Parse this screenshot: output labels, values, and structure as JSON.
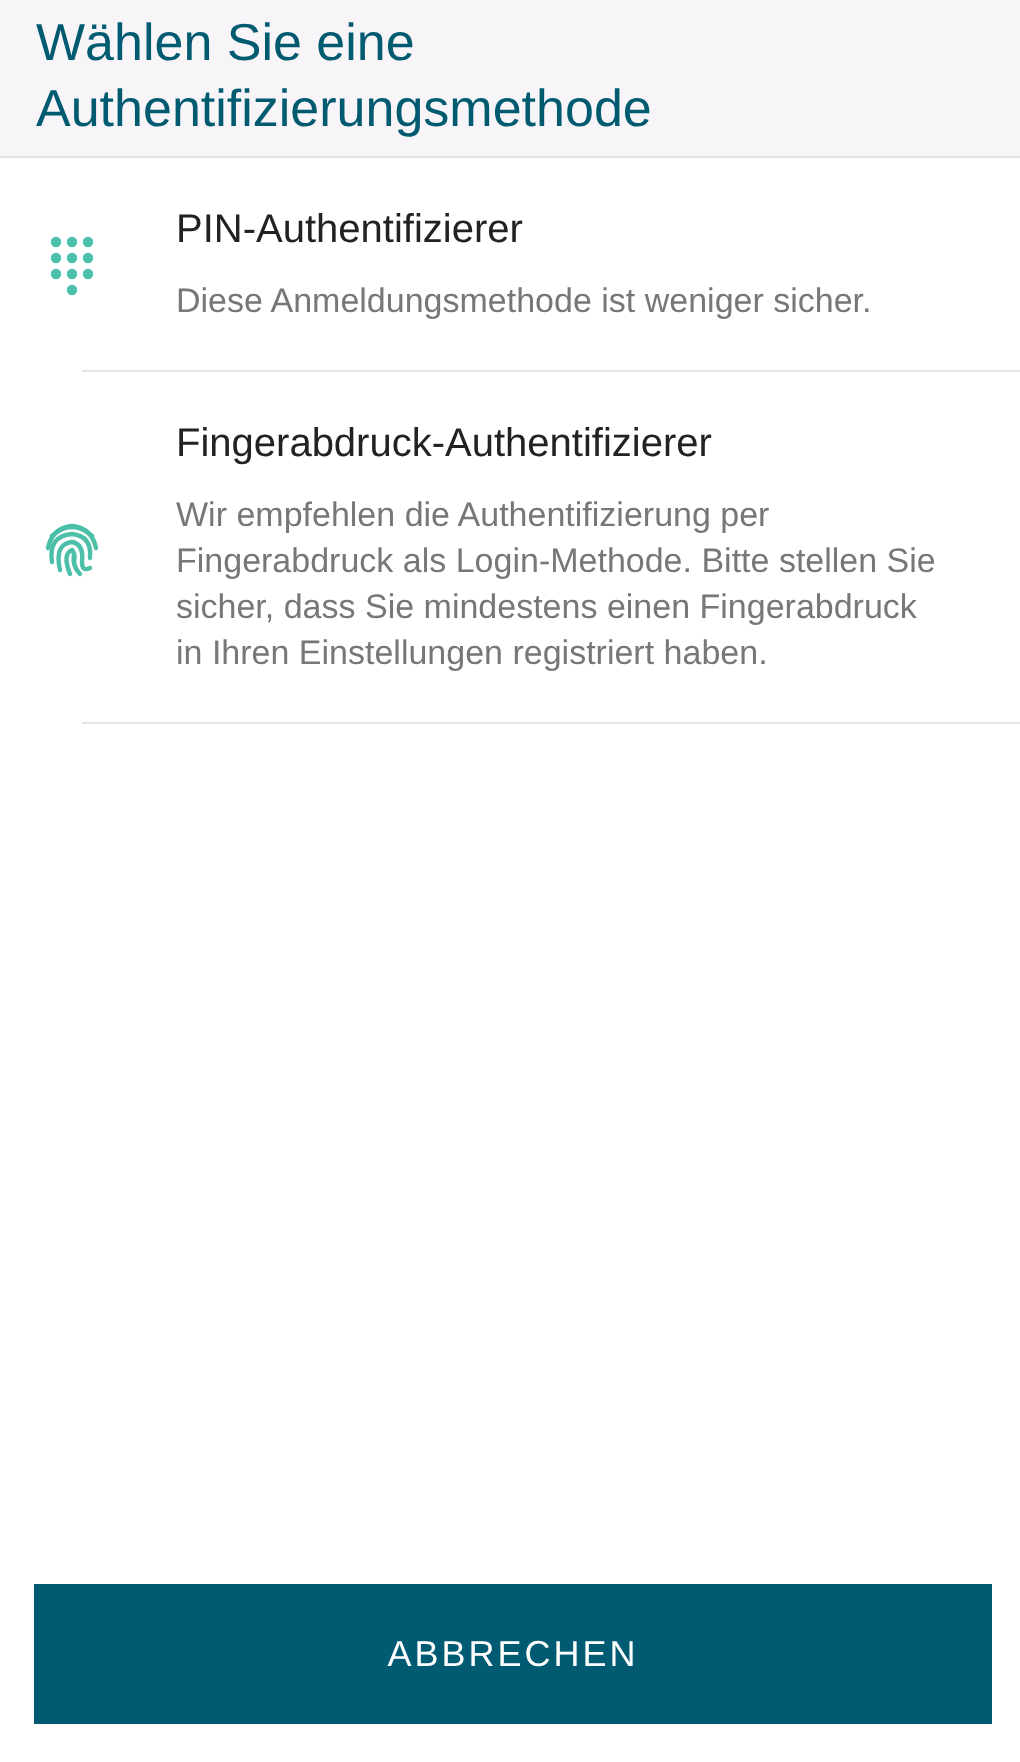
{
  "header": {
    "title": "Wählen Sie eine Authentifizierungsmethode"
  },
  "methods": [
    {
      "kind": "pin",
      "title": "PIN-Authentifizierer",
      "description": "Diese Anmeldungsmethode ist weniger sicher."
    },
    {
      "kind": "fingerprint",
      "title": "Fingerabdruck-Authentifizierer",
      "description": "Wir empfehlen die Authentifizierung per Fingerabdruck als Login-Methode. Bitte stellen Sie sicher, dass Sie mindestens einen Fingerabdruck in Ihren Einstellungen registriert haben."
    }
  ],
  "cancel_button": {
    "label": "ABBRECHEN"
  }
}
